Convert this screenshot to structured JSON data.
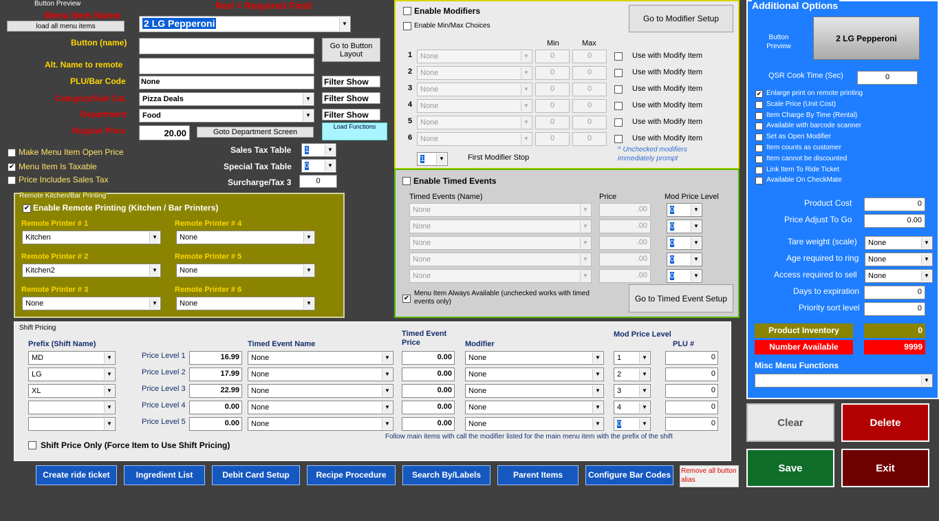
{
  "top": {
    "button_preview_label": "Button Preview",
    "menu_item_name_label": "Menu Item Name",
    "required_note": "Red = Required Field",
    "load_all_btn": "load all menu items",
    "menu_item_name_value": "2 LG Pepperoni",
    "button_name_label": "Button (name)",
    "alt_name_label": "Alt. Name to remote",
    "plu_label": "PLU/Bar Code",
    "plu_value": "None",
    "category_label": "Category/Sub Cat.",
    "category_value": "Pizza Deals",
    "department_label": "Department",
    "department_value": "Food",
    "regular_price_label": "Regular Price",
    "regular_price_value": "20.00",
    "goto_button_layout": "Go to Button Layout",
    "filter_show": "Filter Show",
    "load_functions": "Load Functions",
    "goto_department": "Goto Department Screen",
    "open_price_label": "Make Menu Item Open Price",
    "taxable_label": "Menu Item Is Taxable",
    "price_includes_tax_label": "Price Includes Sales Tax",
    "sales_tax_label": "Sales Tax Table",
    "sales_tax_value": "1",
    "special_tax_label": "Special Tax Table",
    "special_tax_value": "0",
    "surcharge_label": "Surcharge/Tax 3",
    "surcharge_value": "0"
  },
  "remote": {
    "title": "Remote Kitchen/Bar Printing",
    "enable_label": "Enable Remote Printing (Kitchen / Bar Printers)",
    "printers": [
      {
        "label": "Remote Printer # 1",
        "value": "Kitchen"
      },
      {
        "label": "Remote Printer # 2",
        "value": "Kitchen2"
      },
      {
        "label": "Remote Printer # 3",
        "value": "None"
      },
      {
        "label": "Remote Printer # 4",
        "value": "None"
      },
      {
        "label": "Remote Printer # 5",
        "value": "None"
      },
      {
        "label": "Remote Printer # 6",
        "value": "None"
      }
    ]
  },
  "modifiers": {
    "enable_label": "Enable Modifiers",
    "enable_minmax_label": "Enable Min/Max Choices",
    "goto_setup": "Go to Modifier Setup",
    "min_header": "Min",
    "max_header": "Max",
    "rows": [
      {
        "num": "1",
        "value": "None",
        "min": "0",
        "max": "0",
        "use_label": "Use with Modify Item"
      },
      {
        "num": "2",
        "value": "None",
        "min": "0",
        "max": "0",
        "use_label": "Use with Modify Item"
      },
      {
        "num": "3",
        "value": "None",
        "min": "0",
        "max": "0",
        "use_label": "Use with Modify Item"
      },
      {
        "num": "4",
        "value": "None",
        "min": "0",
        "max": "0",
        "use_label": "Use with Modify Item"
      },
      {
        "num": "5",
        "value": "None",
        "min": "0",
        "max": "0",
        "use_label": "Use with Modify Item"
      },
      {
        "num": "6",
        "value": "None",
        "min": "0",
        "max": "0",
        "use_label": "Use with Modify Item"
      }
    ],
    "first_stop_value": "1",
    "first_stop_label": "First Modifier Stop",
    "unchecked_note": "^ Unchecked modifiers immediately prompt"
  },
  "timed": {
    "enable_label": "Enable Timed Events",
    "name_header": "Timed Events (Name)",
    "price_header": "Price",
    "level_header": "Mod Price Level",
    "rows": [
      {
        "value": "None",
        "price": ".00",
        "level": "0"
      },
      {
        "value": "None",
        "price": ".00",
        "level": "0"
      },
      {
        "value": "None",
        "price": ".00",
        "level": "0"
      },
      {
        "value": "None",
        "price": ".00",
        "level": "0"
      },
      {
        "value": "None",
        "price": ".00",
        "level": "0"
      }
    ],
    "always_available_label": "Menu Item Always Available (unchecked works with timed events only)",
    "goto_setup": "Go to Timed Event Setup"
  },
  "shift": {
    "title": "Shift Pricing",
    "prefix_header": "Prefix (Shift Name)",
    "timed_name_header": "Timed Event Name",
    "timed_price_header": "Timed Event Price",
    "modifier_header": "Modifier",
    "mod_level_header": "Mod Price Level",
    "plu_header": "PLU #",
    "rows": [
      {
        "prefix": "MD",
        "level_label": "Price Level 1",
        "price": "16.99",
        "timed": "None",
        "tprice": "0.00",
        "modifier": "None",
        "mlevel": "1",
        "plu": "0"
      },
      {
        "prefix": "LG",
        "level_label": "Price Level 2",
        "price": "17.99",
        "timed": "None",
        "tprice": "0.00",
        "modifier": "None",
        "mlevel": "2",
        "plu": "0"
      },
      {
        "prefix": "XL",
        "level_label": "Price Level 3",
        "price": "22.99",
        "timed": "None",
        "tprice": "0.00",
        "modifier": "None",
        "mlevel": "3",
        "plu": "0"
      },
      {
        "prefix": "",
        "level_label": "Price Level 4",
        "price": "0.00",
        "timed": "None",
        "tprice": "0.00",
        "modifier": "None",
        "mlevel": "4",
        "plu": "0"
      },
      {
        "prefix": "",
        "level_label": "Price Level 5",
        "price": "0.00",
        "timed": "None",
        "tprice": "0.00",
        "modifier": "None",
        "mlevel": "0",
        "plu": "0"
      }
    ],
    "shift_only_label": "Shift Price Only (Force Item to Use Shift Pricing)",
    "follow_note": "Follow main items with call the modifier listed for the main menu item with the prefix of the shift"
  },
  "bottom": {
    "buttons": [
      "Create ride ticket",
      "Ingredient List",
      "Debit Card Setup",
      "Recipe Procedure",
      "Search By/Labels",
      "Parent Items",
      "Configure Bar Codes"
    ],
    "remove_alias": "Remove all button alias"
  },
  "additional": {
    "title": "Additional Options",
    "button_preview_label": "Button Preview",
    "preview_text": "2 LG Pepperoni",
    "qsr_label": "QSR Cook Time (Sec)",
    "qsr_value": "0",
    "options": [
      {
        "label": "Enlarge print on remote printing",
        "checked": "✔"
      },
      {
        "label": "Scale Price (Unit Cost)",
        "checked": ""
      },
      {
        "label": "Item Charge By Time (Rental)",
        "checked": ""
      },
      {
        "label": "Available with barcode scanner",
        "checked": ""
      },
      {
        "label": "Set as Open Modifier",
        "checked": ""
      },
      {
        "label": "Item counts as customer",
        "checked": ""
      },
      {
        "label": "Item cannot be discounted",
        "checked": ""
      },
      {
        "label": "Link Item To Ride Ticket",
        "checked": ""
      },
      {
        "label": "Available On CheckMate",
        "checked": ""
      }
    ],
    "product_cost_label": "Product Cost",
    "product_cost_value": "0",
    "price_adjust_label": "Price Adjust To Go",
    "price_adjust_value": "0.00",
    "tare_label": "Tare weight (scale)",
    "tare_value": "None",
    "age_label": "Age required to ring",
    "age_value": "None",
    "access_label": "Access required to sell",
    "access_value": "None",
    "days_label": "Days to expiration",
    "days_value": "0",
    "priority_label": "Priority sort level",
    "priority_value": "0",
    "inventory_label": "Product Inventory",
    "inventory_value": "0",
    "available_label": "Number Available",
    "available_value": "9999",
    "misc_label": "Misc Menu Functions",
    "misc_value": ""
  },
  "actions": {
    "clear": "Clear",
    "delete": "Delete",
    "save": "Save",
    "exit": "Exit"
  },
  "colors": {
    "bg": "#404040",
    "blue_panel": "#1e7eff",
    "olive_panel": "#8a8400",
    "label_yellow": "#ffd700",
    "required_red": "#e60000"
  }
}
